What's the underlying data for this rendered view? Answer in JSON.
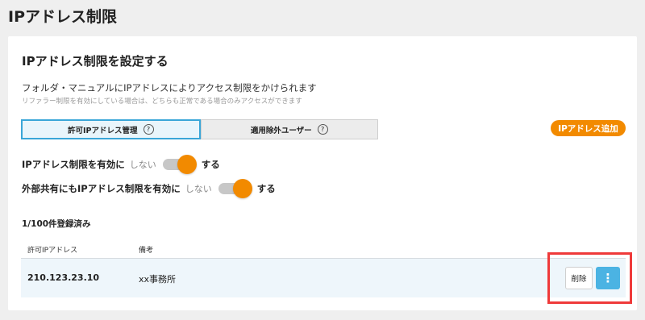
{
  "page": {
    "title": "IPアドレス制限"
  },
  "card": {
    "title": "IPアドレス制限を設定する",
    "description": "フォルダ・マニュアルにIPアドレスによりアクセス制限をかけられます",
    "subdescription": "リファラー制限を有効にしている場合は、どちらも正常である場合のみアクセスができます"
  },
  "tabs": [
    {
      "label": "許可IPアドレス管理",
      "help": "?",
      "active": true
    },
    {
      "label": "適用除外ユーザー",
      "help": "?",
      "active": false
    }
  ],
  "add_button": {
    "label": "IPアドレス追加"
  },
  "toggles": [
    {
      "label": "IPアドレス制限を有効に",
      "off_label": "しない",
      "on_label": "する",
      "enabled": true
    },
    {
      "label": "外部共有にもIPアドレス制限を有効に",
      "off_label": "しない",
      "on_label": "する",
      "enabled": true
    }
  ],
  "count_text": "1/100件登録済み",
  "table": {
    "headers": [
      "許可IPアドレス",
      "備考"
    ],
    "rows": [
      {
        "ip": "210.123.23.10",
        "note": "xx事務所",
        "delete_label": "削除",
        "more_icon": "vertical-dots-icon",
        "more_glyph": "⋮"
      }
    ]
  },
  "colors": {
    "accent_orange": "#f28a00",
    "accent_blue": "#4bb3e3",
    "highlight_red": "#ef3a3a"
  }
}
